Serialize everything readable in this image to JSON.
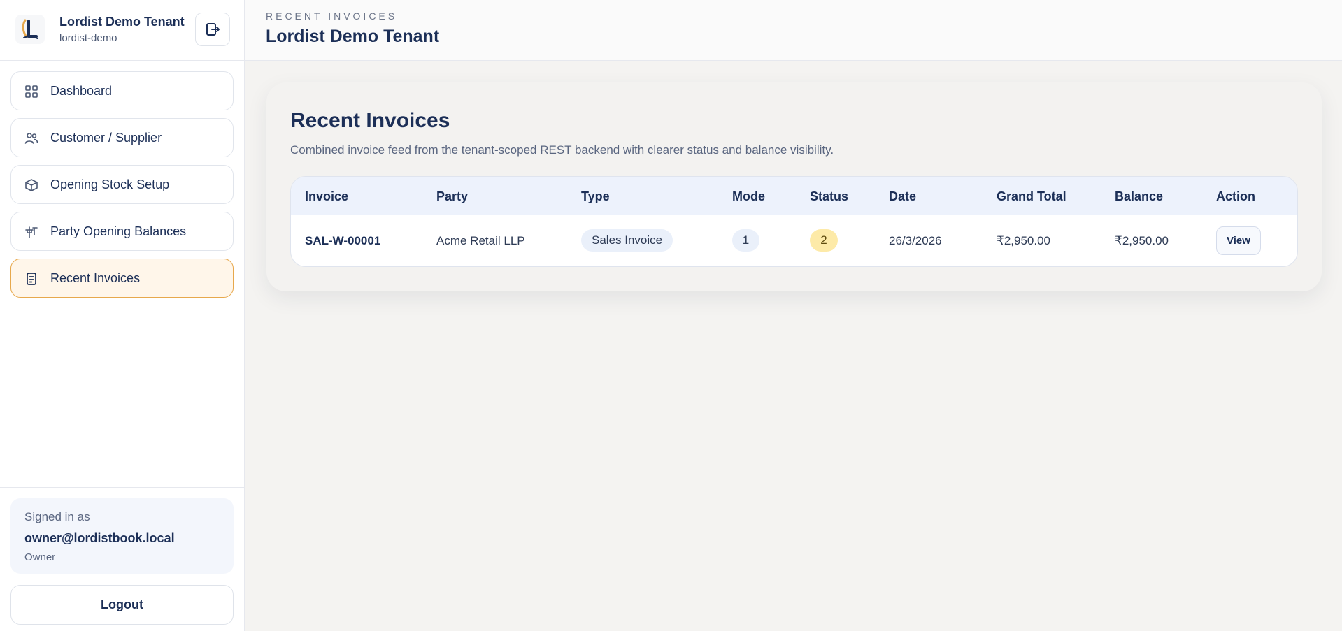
{
  "brand": {
    "name": "Lordist Demo Tenant",
    "slug": "lordist-demo"
  },
  "sidebar": {
    "items": [
      {
        "label": "Dashboard",
        "icon": "grid-icon"
      },
      {
        "label": "Customer / Supplier",
        "icon": "users-icon"
      },
      {
        "label": "Opening Stock Setup",
        "icon": "box-icon"
      },
      {
        "label": "Party Opening Balances",
        "icon": "scale-icon"
      },
      {
        "label": "Recent Invoices",
        "icon": "receipt-icon",
        "active": true
      }
    ],
    "signed_in_label": "Signed in as",
    "email": "owner@lordistbook.local",
    "role": "Owner",
    "logout_label": "Logout"
  },
  "header": {
    "eyebrow": "RECENT INVOICES",
    "title": "Lordist Demo Tenant"
  },
  "main": {
    "title": "Recent Invoices",
    "description": "Combined invoice feed from the tenant-scoped REST backend with clearer status and balance visibility.",
    "columns": [
      "Invoice",
      "Party",
      "Type",
      "Mode",
      "Status",
      "Date",
      "Grand Total",
      "Balance",
      "Action"
    ],
    "rows": [
      {
        "invoice": "SAL-W-00001",
        "party": "Acme Retail LLP",
        "type": "Sales Invoice",
        "mode": "1",
        "status": "2",
        "date": "26/3/2026",
        "grand_total": "₹2,950.00",
        "balance": "₹2,950.00",
        "action": "View"
      }
    ]
  },
  "colors": {
    "accent": "#e7a84c",
    "primary_text": "#1c2f57",
    "active_bg": "#fff6ea",
    "status_pill": "#fdeaa8"
  }
}
